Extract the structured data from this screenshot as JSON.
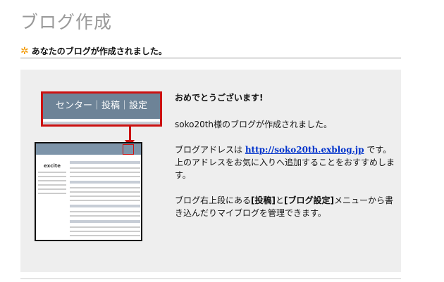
{
  "header": {
    "title": "ブログ作成"
  },
  "subhead": {
    "star": "✲",
    "text": "あなたのブログが作成されました。"
  },
  "callout": {
    "menu_text": "センター｜投稿｜設定"
  },
  "thumbnail": {
    "logo_text": "excite"
  },
  "message": {
    "congrats": "おめでとうございます!",
    "created": "soko20th様のブログが作成されました。",
    "address_prefix": "ブログアドレスは ",
    "address_link": "http://soko20th.exblog.jp",
    "address_suffix": " です。",
    "favorites": "上のアドレスをお気に入りへ追加することをおすすめします。",
    "manage_prefix": "ブログ右上段にある",
    "manage_post": "[投稿]",
    "manage_and": "と",
    "manage_settings": "[ブログ設定]",
    "manage_suffix": "メニューから書き込んだりマイブログを管理できます。"
  },
  "colors": {
    "accent_star": "#f39800",
    "callout_border": "#cc1111",
    "link": "#0033cc"
  }
}
